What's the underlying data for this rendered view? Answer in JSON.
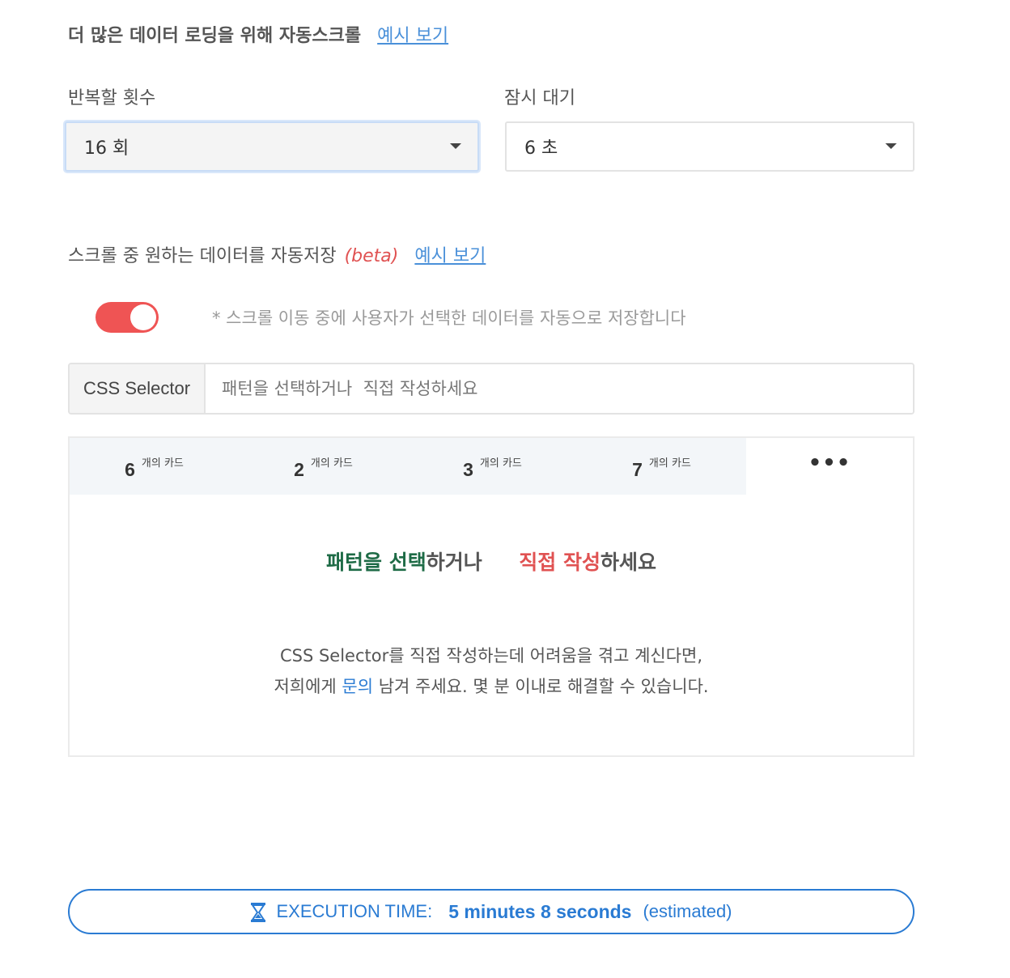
{
  "autoscroll": {
    "title": "더 많은 데이터 로딩을 위해 자동스크롤",
    "example_link": "예시 보기"
  },
  "repeat": {
    "label": "반복할 횟수",
    "value": "16 회"
  },
  "wait": {
    "label": "잠시 대기",
    "value": "6 초"
  },
  "autosave": {
    "title": "스크롤 중 원하는 데이터를 자동저장",
    "beta": "(beta)",
    "example_link": "예시 보기",
    "toggle_on": true,
    "hint": "* 스크롤 이동 중에 사용자가 선택한 데이터를 자동으로 저장합니다"
  },
  "css_selector": {
    "addon_label": "CSS Selector",
    "placeholder": "패턴을 선택하거나  직접 작성하세요"
  },
  "tabs": [
    {
      "count": "6",
      "unit": "개의 카드"
    },
    {
      "count": "2",
      "unit": "개의 카드"
    },
    {
      "count": "3",
      "unit": "개의 카드"
    },
    {
      "count": "7",
      "unit": "개의 카드"
    }
  ],
  "more_tab": "•••",
  "panel": {
    "headline": {
      "pattern": "패턴을",
      "select": "선택",
      "or": "하거나",
      "direct": "직접",
      "write": "작성",
      "please": "하세요"
    },
    "help_line1": "CSS Selector를 직접 작성하는데 어려움을 겪고 계신다면,",
    "help_line2_pre": "저희에게 ",
    "help_link": "문의",
    "help_line2_post": " 남겨 주세요. 몇 분 이내로 해결할 수 있습니다."
  },
  "execution": {
    "label": "EXECUTION TIME:",
    "value": "5 minutes 8 seconds",
    "estimated": "(estimated)"
  },
  "colors": {
    "accent": "#2a7bd3",
    "toggle": "#ef5454",
    "green": "#1e6b46",
    "red": "#e05252"
  },
  "icons": [
    "caret-down-icon",
    "hourglass-icon",
    "more-dots-icon"
  ]
}
